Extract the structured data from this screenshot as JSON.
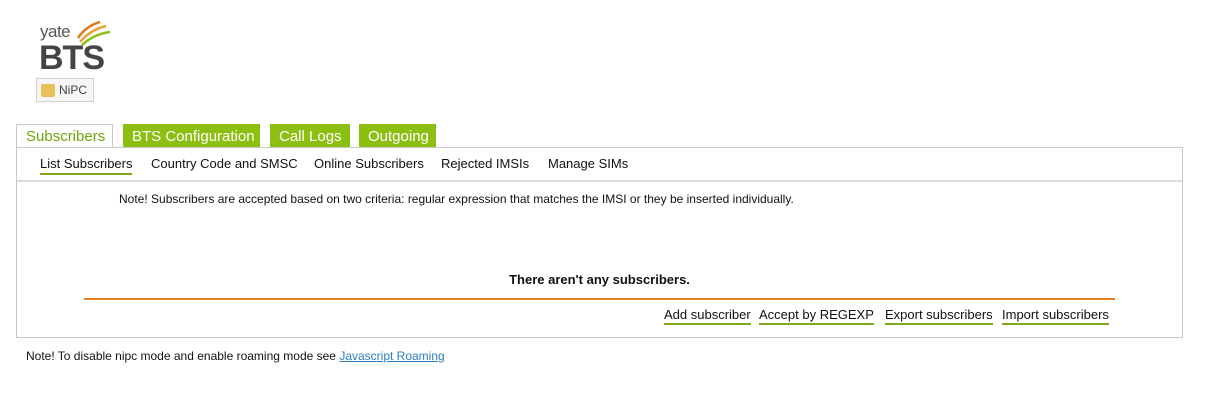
{
  "logo": {
    "yate": "yate",
    "bts": "BTS",
    "nipc": "NiPC",
    "icon": "cell-tower-signal-icon"
  },
  "tabs": [
    {
      "label": "Subscribers",
      "active": true
    },
    {
      "label": "BTS Configuration",
      "active": false
    },
    {
      "label": "Call Logs",
      "active": false
    },
    {
      "label": "Outgoing",
      "active": false
    }
  ],
  "subnav": [
    {
      "label": "List Subscribers",
      "active": true
    },
    {
      "label": "Country Code and SMSC",
      "active": false
    },
    {
      "label": "Online Subscribers",
      "active": false
    },
    {
      "label": "Rejected IMSIs",
      "active": false
    },
    {
      "label": "Manage SIMs",
      "active": false
    }
  ],
  "content": {
    "note": "Note! Subscribers are accepted based on two criteria: regular expression that matches the IMSI or they be inserted individually.",
    "empty_message": "There aren't any subscribers.",
    "actions": [
      {
        "label": "Add subscriber"
      },
      {
        "label": "Accept by REGEXP"
      },
      {
        "label": "Export subscribers"
      },
      {
        "label": "Import subscribers"
      }
    ]
  },
  "footer": {
    "note_text": "Note! To disable nipc mode and enable roaming mode see ",
    "link_label": "Javascript Roaming"
  },
  "colors": {
    "tab_green": "#8cbf12",
    "active_text_green": "#6ea50a",
    "underline_green": "#7fa81d",
    "orange_rule": "#e67e22",
    "link_blue": "#2b7fc1"
  }
}
